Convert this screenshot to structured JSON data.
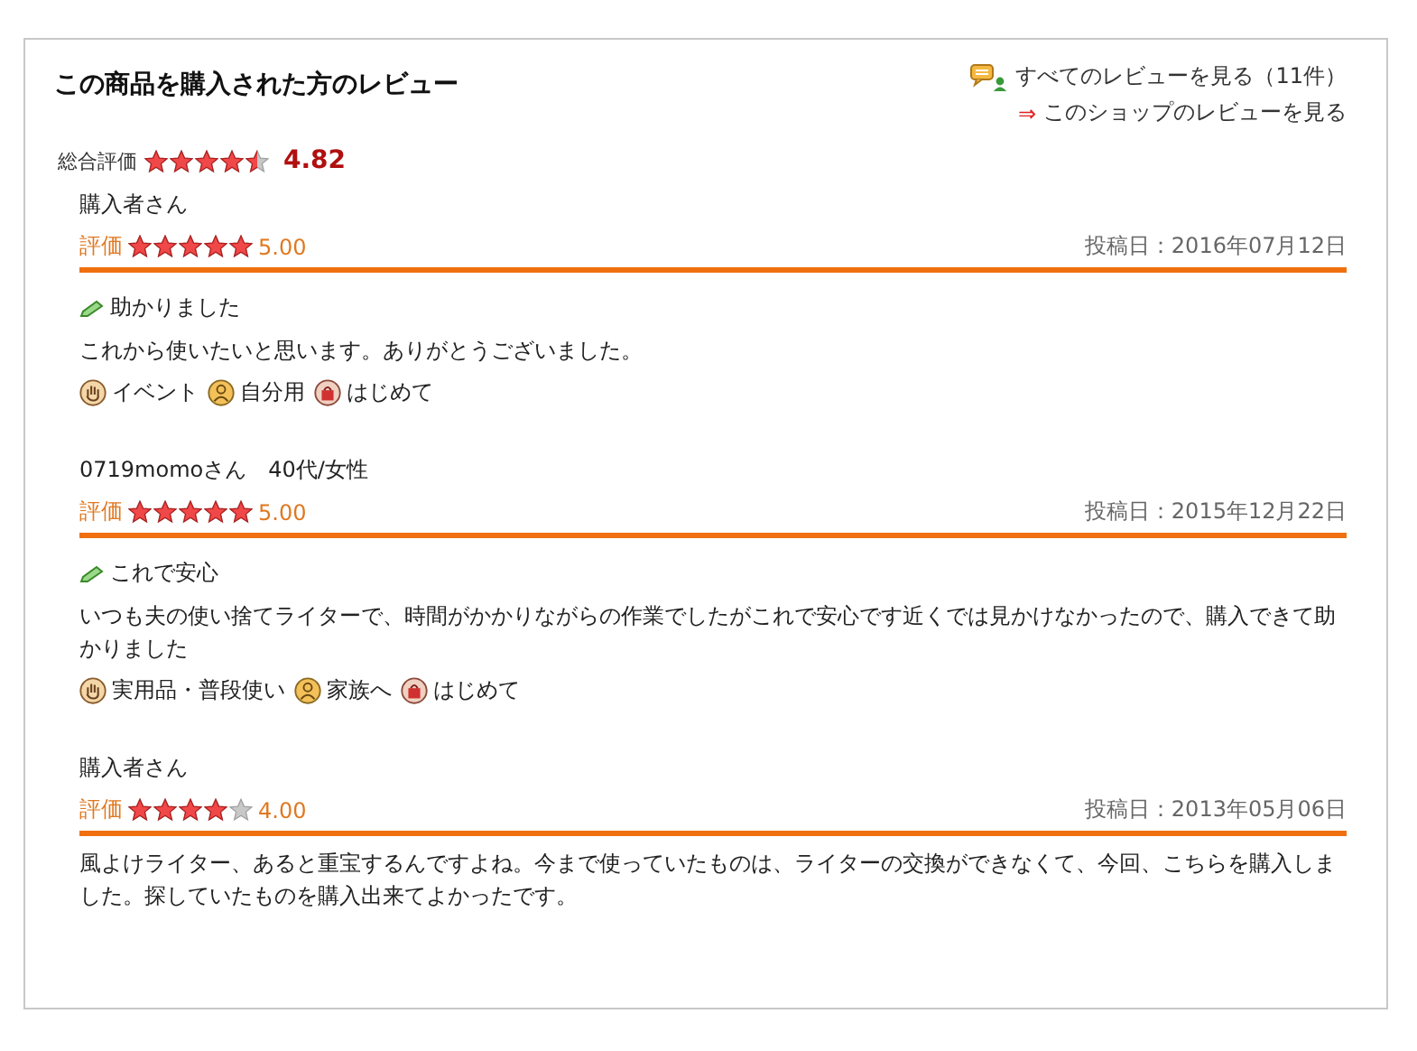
{
  "header": {
    "title": "この商品を購入された方のレビュー",
    "all_reviews_link": "すべてのレビューを見る（11件）",
    "shop_arrow": "⇒",
    "shop_reviews_link": "このショップのレビューを見る"
  },
  "overall": {
    "label": "総合評価",
    "stars": 4.5,
    "score": "4.82"
  },
  "reviews": [
    {
      "reviewer": "購入者さん",
      "rating_label": "評価",
      "stars": 5,
      "score": "5.00",
      "date": "投稿日：2016年07月12日",
      "title": "助かりました",
      "body": "これから使いたいと思います。ありがとうございました。",
      "tags": [
        {
          "kind": "purpose",
          "label": "イベント"
        },
        {
          "kind": "user",
          "label": "自分用"
        },
        {
          "kind": "frequency",
          "label": "はじめて"
        }
      ]
    },
    {
      "reviewer": "0719momoさん　40代/女性",
      "rating_label": "評価",
      "stars": 5,
      "score": "5.00",
      "date": "投稿日：2015年12月22日",
      "title": "これで安心",
      "body": "いつも夫の使い捨てライターで、時間がかかりながらの作業でしたがこれで安心です近くでは見かけなかったので、購入できて助かりました",
      "tags": [
        {
          "kind": "purpose",
          "label": "実用品・普段使い"
        },
        {
          "kind": "user",
          "label": "家族へ"
        },
        {
          "kind": "frequency",
          "label": "はじめて"
        }
      ]
    },
    {
      "reviewer": "購入者さん",
      "rating_label": "評価",
      "stars": 4,
      "score": "4.00",
      "date": "投稿日：2013年05月06日",
      "body": "風よけライター、あると重宝するんですよね。今まで使っていたものは、ライターの交換ができなくて、今回、こちらを購入しました。探していたものを購入出来てよかったです。"
    }
  ]
}
